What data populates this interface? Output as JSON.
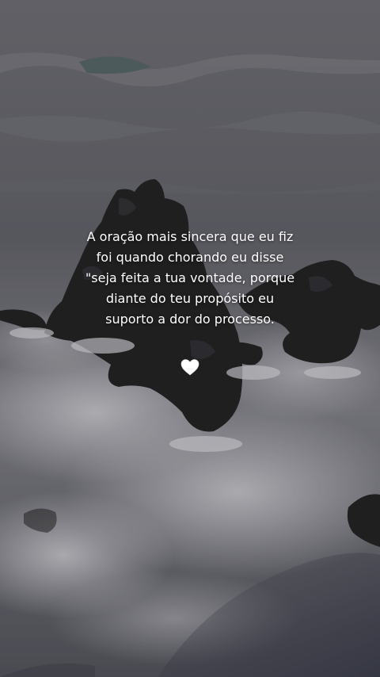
{
  "quote": {
    "lines": [
      "A oração mais sincera que eu fiz",
      "foi quando chorando eu disse",
      "\"seja feita a tua vontade, porque",
      "diante do teu propósito eu",
      "suporto a dor do processo."
    ]
  },
  "heart": {
    "icon": "white-heart-icon",
    "color": "#ffffff"
  },
  "colors": {
    "sea": "#6e6e76",
    "foam": "#c9c9cf",
    "rock": "#262628"
  }
}
